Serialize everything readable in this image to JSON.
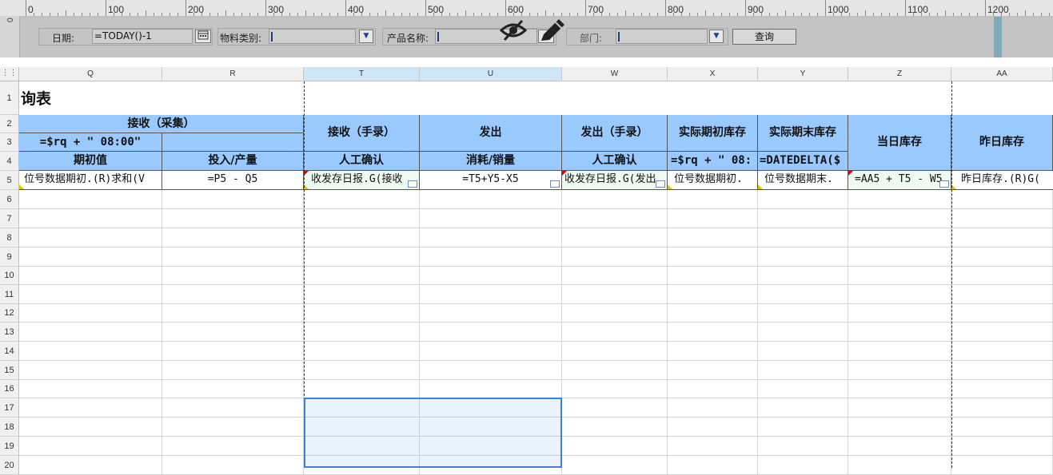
{
  "ruler": {
    "origin_label": "0",
    "labels": [
      "0",
      "100",
      "200",
      "300",
      "400",
      "500",
      "600",
      "700",
      "800",
      "900",
      "1000",
      "1100",
      "1200"
    ]
  },
  "toolbar": {
    "date_label": "日期:",
    "date_value": "=TODAY()-1",
    "material_label": "物料类别:",
    "product_label": "产品名称:",
    "dept_label": "部门:",
    "query_label": "查询"
  },
  "sheet": {
    "corner_icon": "grid-dots-icon",
    "columns": [
      "Q",
      "R",
      "T",
      "U",
      "W",
      "X",
      "Y",
      "Z",
      "AA"
    ],
    "rows": [
      "1",
      "2",
      "3",
      "4",
      "5",
      "6",
      "7",
      "8",
      "9",
      "10",
      "11",
      "12",
      "13",
      "14",
      "15",
      "16",
      "17",
      "18",
      "19",
      "20"
    ],
    "title": "询表",
    "headers": {
      "recv_collect": "接收（采集）",
      "rq_formula": "=$rq + \" 08:00\"",
      "opening": "期初值",
      "input_output": "投入/产量",
      "recv_manual": "接收（手录）",
      "manual_confirm_1": "人工确认",
      "dispatch": "发出",
      "consume_sales": "消耗/销量",
      "dispatch_manual": "发出（手录）",
      "manual_confirm_2": "人工确认",
      "actual_opening": "实际期初库存",
      "x_formula": "=$rq + \" 08:",
      "actual_closing": "实际期末库存",
      "y_formula": "=DATEDELTA($",
      "today_stock": "当日库存",
      "yesterday_stock": "昨日库存"
    },
    "row5": {
      "Q": "位号数据期初.(R)求和(V",
      "R": "=P5 - Q5",
      "T": "收发存日报.G(接收",
      "U": "=T5+Y5-X5",
      "W": "收发存日报.G(发出",
      "X": "位号数据期初.",
      "Y": "位号数据期末.",
      "Z": "=AA5 + T5 - W5",
      "AA": "昨日库存.(R)G("
    }
  }
}
